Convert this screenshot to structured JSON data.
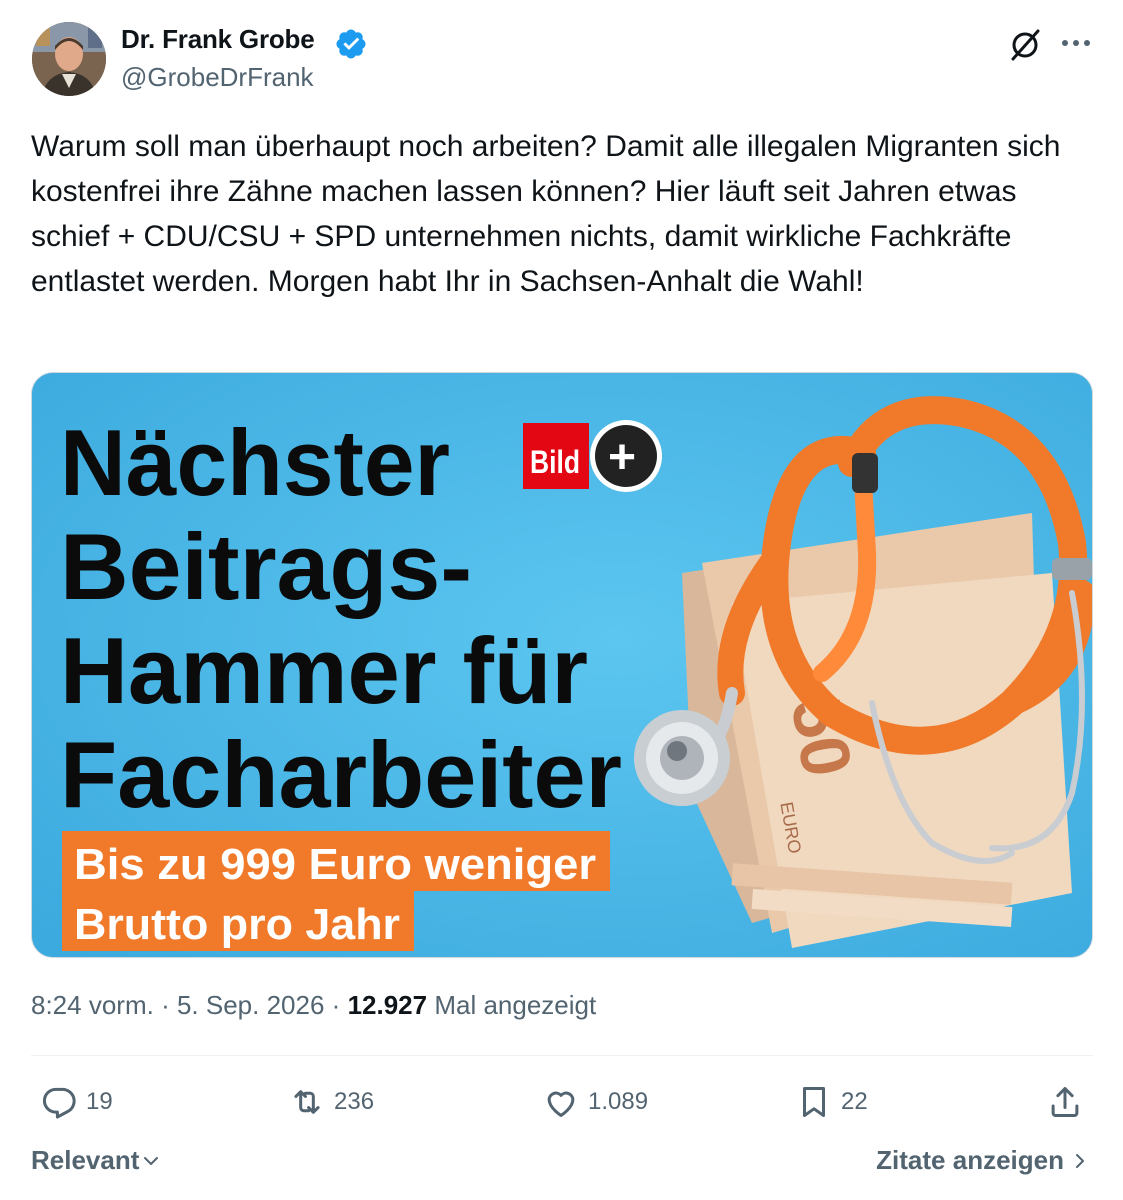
{
  "author": {
    "name": "Dr. Frank Grobe",
    "handle": "@GrobeDrFrank",
    "avatar_icon": "profile-photo",
    "verified_icon": "verified-badge-icon",
    "verified_color": "#1d9bf0"
  },
  "tweet": {
    "text": "Warum soll man überhaupt noch arbeiten? Damit alle illegalen Migranten sich kostenfrei ihre Zähne machen lassen können? Hier läuft seit Jahren etwas schief + CDU/CSU + SPD unternehmen nichts, damit wirkliche Fachkräfte entlastet werden. Morgen habt Ihr in Sachsen-Anhalt die Wahl!"
  },
  "media": {
    "headline_lines": [
      "Nächster",
      "Beitrags-",
      "Hammer für",
      "Facharbeiter"
    ],
    "logo_text": "Bild",
    "logo_plus": "+",
    "sub_lines": [
      "Bis zu 999 Euro weniger",
      "Brutto pro Jahr"
    ],
    "banknote_value": "50",
    "banknote_currency": "EURO",
    "background_color": "#4bb8e6",
    "accent_color": "#f07a2a",
    "logo_color": "#e30613"
  },
  "meta": {
    "time": "8:24 vorm.",
    "separator": "·",
    "date": "5. Sep. 2026",
    "views_count": "12.927",
    "views_label": "Mal angezeigt"
  },
  "actions": {
    "reply_count": "19",
    "retweet_count": "236",
    "like_count": "1.089",
    "bookmark_count": "22"
  },
  "footer": {
    "sort_label": "Relevant",
    "quotes_label": "Zitate anzeigen"
  }
}
